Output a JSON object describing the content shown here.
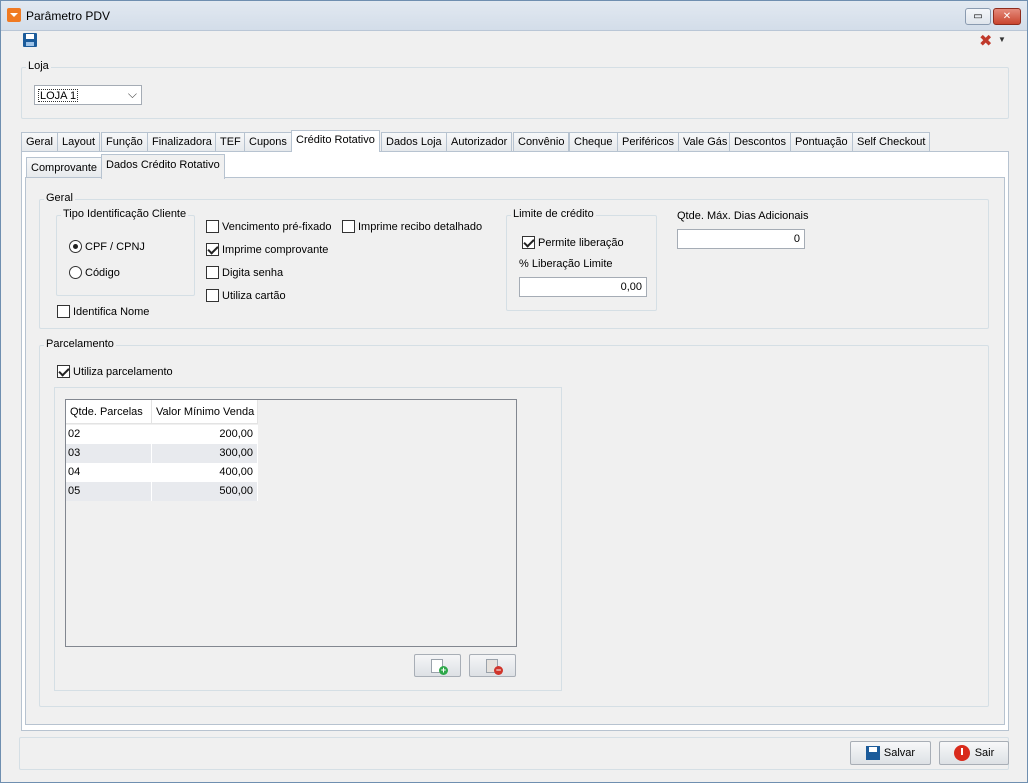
{
  "window": {
    "title": "Parâmetro PDV"
  },
  "loja": {
    "group_label": "Loja",
    "selected": "LOJA 1"
  },
  "tabs": [
    "Geral",
    "Layout",
    "Função",
    "Finalizadora",
    "TEF",
    "Cupons",
    "Crédito Rotativo",
    "Dados Loja",
    "Autorizador",
    "Convênio",
    "Cheque",
    "Periféricos",
    "Vale Gás",
    "Descontos",
    "Pontuação",
    "Self Checkout"
  ],
  "active_tab": "Crédito Rotativo",
  "subtabs": [
    "Comprovante",
    "Dados Crédito Rotativo"
  ],
  "active_subtab": "Dados Crédito Rotativo",
  "geral": {
    "title": "Geral",
    "tipo_identificacao": {
      "title": "Tipo Identificação Cliente",
      "options": [
        "CPF / CPNJ",
        "Código"
      ],
      "selected": "CPF / CPNJ"
    },
    "identifica_nome": {
      "label": "Identifica Nome",
      "checked": false
    },
    "checkboxes": {
      "vencimento": {
        "label": "Vencimento pré-fixado",
        "checked": false
      },
      "imprime_recibo": {
        "label": "Imprime recibo detalhado",
        "checked": false
      },
      "imprime_comprovante": {
        "label": "Imprime comprovante",
        "checked": true
      },
      "digita_senha": {
        "label": "Digita senha",
        "checked": false
      },
      "utiliza_cartao": {
        "label": "Utiliza cartão",
        "checked": false
      }
    },
    "limite": {
      "title": "Limite de crédito",
      "permite_liberacao": {
        "label": "Permite liberação",
        "checked": true
      },
      "perc_label": "% Liberação Limite",
      "perc_value": "0,00"
    },
    "dias": {
      "label": "Qtde. Máx. Dias Adicionais",
      "value": "0"
    }
  },
  "parcelamento": {
    "title": "Parcelamento",
    "utiliza": {
      "label": "Utiliza parcelamento",
      "checked": true
    },
    "columns": [
      "Qtde. Parcelas",
      "Valor Mínimo Venda"
    ],
    "rows": [
      [
        "02",
        "200,00"
      ],
      [
        "03",
        "300,00"
      ],
      [
        "04",
        "400,00"
      ],
      [
        "05",
        "500,00"
      ]
    ]
  },
  "buttons": {
    "salvar": "Salvar",
    "sair": "Sair"
  }
}
